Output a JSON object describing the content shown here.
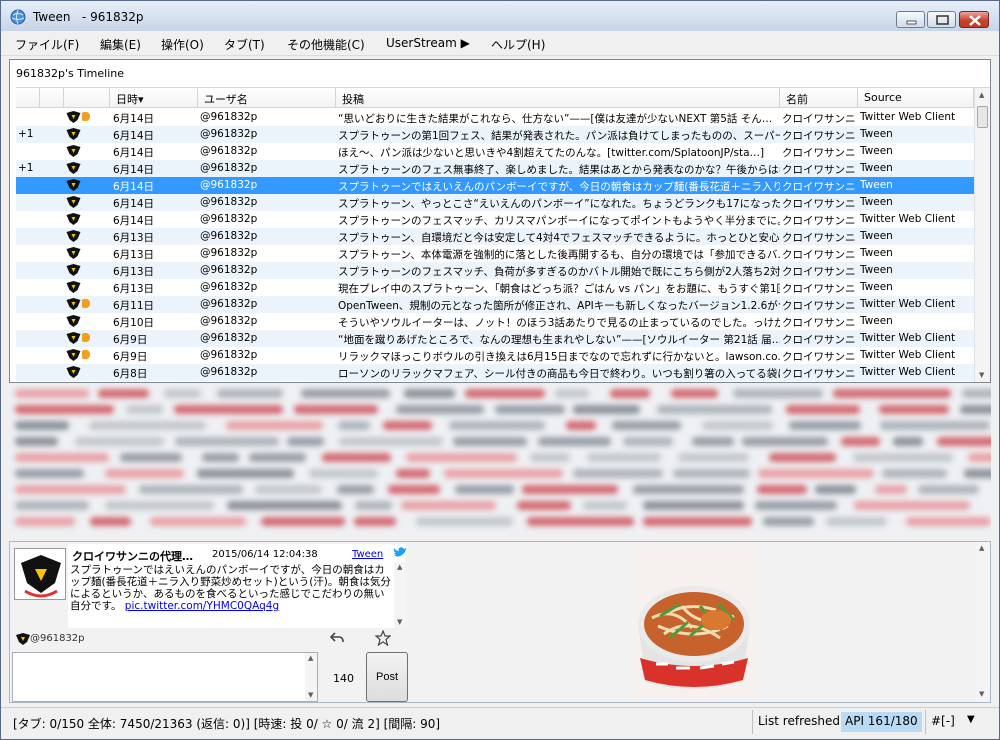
{
  "window": {
    "title": "Tween",
    "account": "961832p"
  },
  "menu": {
    "items": [
      "ファイル(F)",
      "編集(E)",
      "操作(O)",
      "タブ(T)",
      "その他機能(C)",
      "UserStream ▶",
      "ヘルプ(H)"
    ]
  },
  "timeline": {
    "tab_label": "961832p's Timeline",
    "columns": [
      "日時▾",
      "ユーザ名",
      "投稿",
      "名前",
      "Source"
    ],
    "rows": [
      {
        "mark": "",
        "fav": true,
        "date": "6月14日",
        "user": "@961832p",
        "post": "“思いどおりに生きた結果がこれなら、仕方ない”——[僕は友達が少ないNEXT 第5話 そん…",
        "name": "クロイワサンニ",
        "source": "Twitter Web Client"
      },
      {
        "mark": "+1",
        "fav": false,
        "date": "6月14日",
        "user": "@961832p",
        "post": "スプラトゥーンの第1回フェス、結果が発表された。パン派は負けてしまったものの、スーパーサザ…",
        "name": "クロイワサンニ",
        "source": "Tween"
      },
      {
        "mark": "",
        "fav": false,
        "date": "6月14日",
        "user": "@961832p",
        "post": "ほえ〜、パン派は少ないと思いきや4割超えてたのんな。[twitter.com/SplatoonJP/sta…]",
        "name": "クロイワサンニ",
        "source": "Tween"
      },
      {
        "mark": "+1",
        "fav": false,
        "date": "6月14日",
        "user": "@961832p",
        "post": "スプラトゥーンのフェス無事終了、楽しめました。結果はあとから発表なのかな？午後からはギリ…",
        "name": "クロイワサンニ",
        "source": "Tween"
      },
      {
        "mark": "",
        "fav": false,
        "date": "6月14日",
        "user": "@961832p",
        "post": "スプラトゥーンではえいえんのパンボーイですが、今日の朝食はカップ麺(番長花道＋ニラ入り野…",
        "name": "クロイワサンニ",
        "source": "Tween",
        "selected": true
      },
      {
        "mark": "",
        "fav": false,
        "date": "6月14日",
        "user": "@961832p",
        "post": "スプラトゥーン、やっとこさ“えいえんのパンボーイ”になれた。ちょうどランクも17になったので、も…",
        "name": "クロイワサンニ",
        "source": "Tween"
      },
      {
        "mark": "",
        "fav": false,
        "date": "6月14日",
        "user": "@961832p",
        "post": "スプラトゥーンのフェスマッチ、カリスマパンボーイになってポイントもようやく半分までに。プレイ続け…",
        "name": "クロイワサンニ",
        "source": "Twitter Web Client"
      },
      {
        "mark": "",
        "fav": false,
        "date": "6月13日",
        "user": "@961832p",
        "post": "スプラトゥーン、自環境だと今は安定して4対4でフェスマッチできるように。ホっとひと安心。ランク…",
        "name": "クロイワサンニ",
        "source": "Tween"
      },
      {
        "mark": "",
        "fav": false,
        "date": "6月13日",
        "user": "@961832p",
        "post": "スプラトゥーン、本体電源を強制的に落とした後再開するも、自分の環境では「参加できるバ…",
        "name": "クロイワサンニ",
        "source": "Tween"
      },
      {
        "mark": "",
        "fav": false,
        "date": "6月13日",
        "user": "@961832p",
        "post": "スプラトゥーンのフェスマッチ、負荷が多すぎるのかバトル開始で既にこちら側が2人落ち2対4の…",
        "name": "クロイワサンニ",
        "source": "Tween"
      },
      {
        "mark": "",
        "fav": false,
        "date": "6月13日",
        "user": "@961832p",
        "post": "現在プレイ中のスプラトゥーン、「朝食はどっち派？ごはん vs パン」をお題に、もうすぐ第1回目…",
        "name": "クロイワサンニ",
        "source": "Tween"
      },
      {
        "mark": "",
        "fav": true,
        "date": "6月11日",
        "user": "@961832p",
        "post": "OpenTween、規制の元となった箇所が修正され、APIキーも新しくなったバージョン1.2.6がつい…",
        "name": "クロイワサンニ",
        "source": "Twitter Web Client"
      },
      {
        "mark": "",
        "fav": false,
        "date": "6月10日",
        "user": "@961832p",
        "post": "そういやソウルイーターは、ノット！のほう3話あたりで見るの止まっているのでした。っけか、今ク…",
        "name": "クロイワサンニ",
        "source": "Tween"
      },
      {
        "mark": "",
        "fav": true,
        "date": "6月9日",
        "user": "@961832p",
        "post": "“地面を蹴りあげたところで、なんの理想も生まれやしない”——[ソウルイーター 第21話 届…",
        "name": "クロイワサンニ",
        "source": "Twitter Web Client"
      },
      {
        "mark": "",
        "fav": true,
        "date": "6月9日",
        "user": "@961832p",
        "post": "リラックマほっこりボウルの引き換えは6月15日までなので忘れずに行かないと。lawson.co.jp/ca…",
        "name": "クロイワサンニ",
        "source": "Twitter Web Client"
      },
      {
        "mark": "",
        "fav": false,
        "date": "6月8日",
        "user": "@961832p",
        "post": "ローソンのリラックマフェア、シール付きの商品も今日で終わり。いつも割り箸の入ってる袋にシー…",
        "name": "クロイワサンニ",
        "source": "Twitter Web Client"
      }
    ]
  },
  "detail": {
    "name": "クロイワサンニの代理…",
    "time": "2015/06/14 12:04:38",
    "source": "Tween",
    "text": "スプラトゥーンではえいえんのパンボーイですが、今日の朝食はカップ麺(番長花道＋ニラ入り野菜炒めセット)という(汗)。朝食は気分によるというか、あるものを食べるといった感じでこだわりの無い自分です。",
    "link": "pic.twitter.com/YHMC0QAq4g",
    "screen_name": "@961832p",
    "char_count": "140",
    "post_label": "Post"
  },
  "status": {
    "main": "[タブ: 0/150 全体: 7450/21363 (返信: 0)] [時速: 投 0/ ☆ 0/ 流 2] [間隔: 90]",
    "refresh": "List refreshed",
    "api": "API 161/180",
    "hash": "#[-]"
  },
  "icons": {
    "app": "globe-icon",
    "row_avatar": "avatar-icon",
    "fav": "fav-heart-icon",
    "bird": "twitter-bird-icon",
    "reply": "reply-icon",
    "fav_star": "star-icon"
  },
  "colors": {
    "selection": "#3399ff",
    "alt_row": "#ecf4fb",
    "api_highlight": "#b9daf5",
    "twitter_blue": "#1da1f2"
  }
}
